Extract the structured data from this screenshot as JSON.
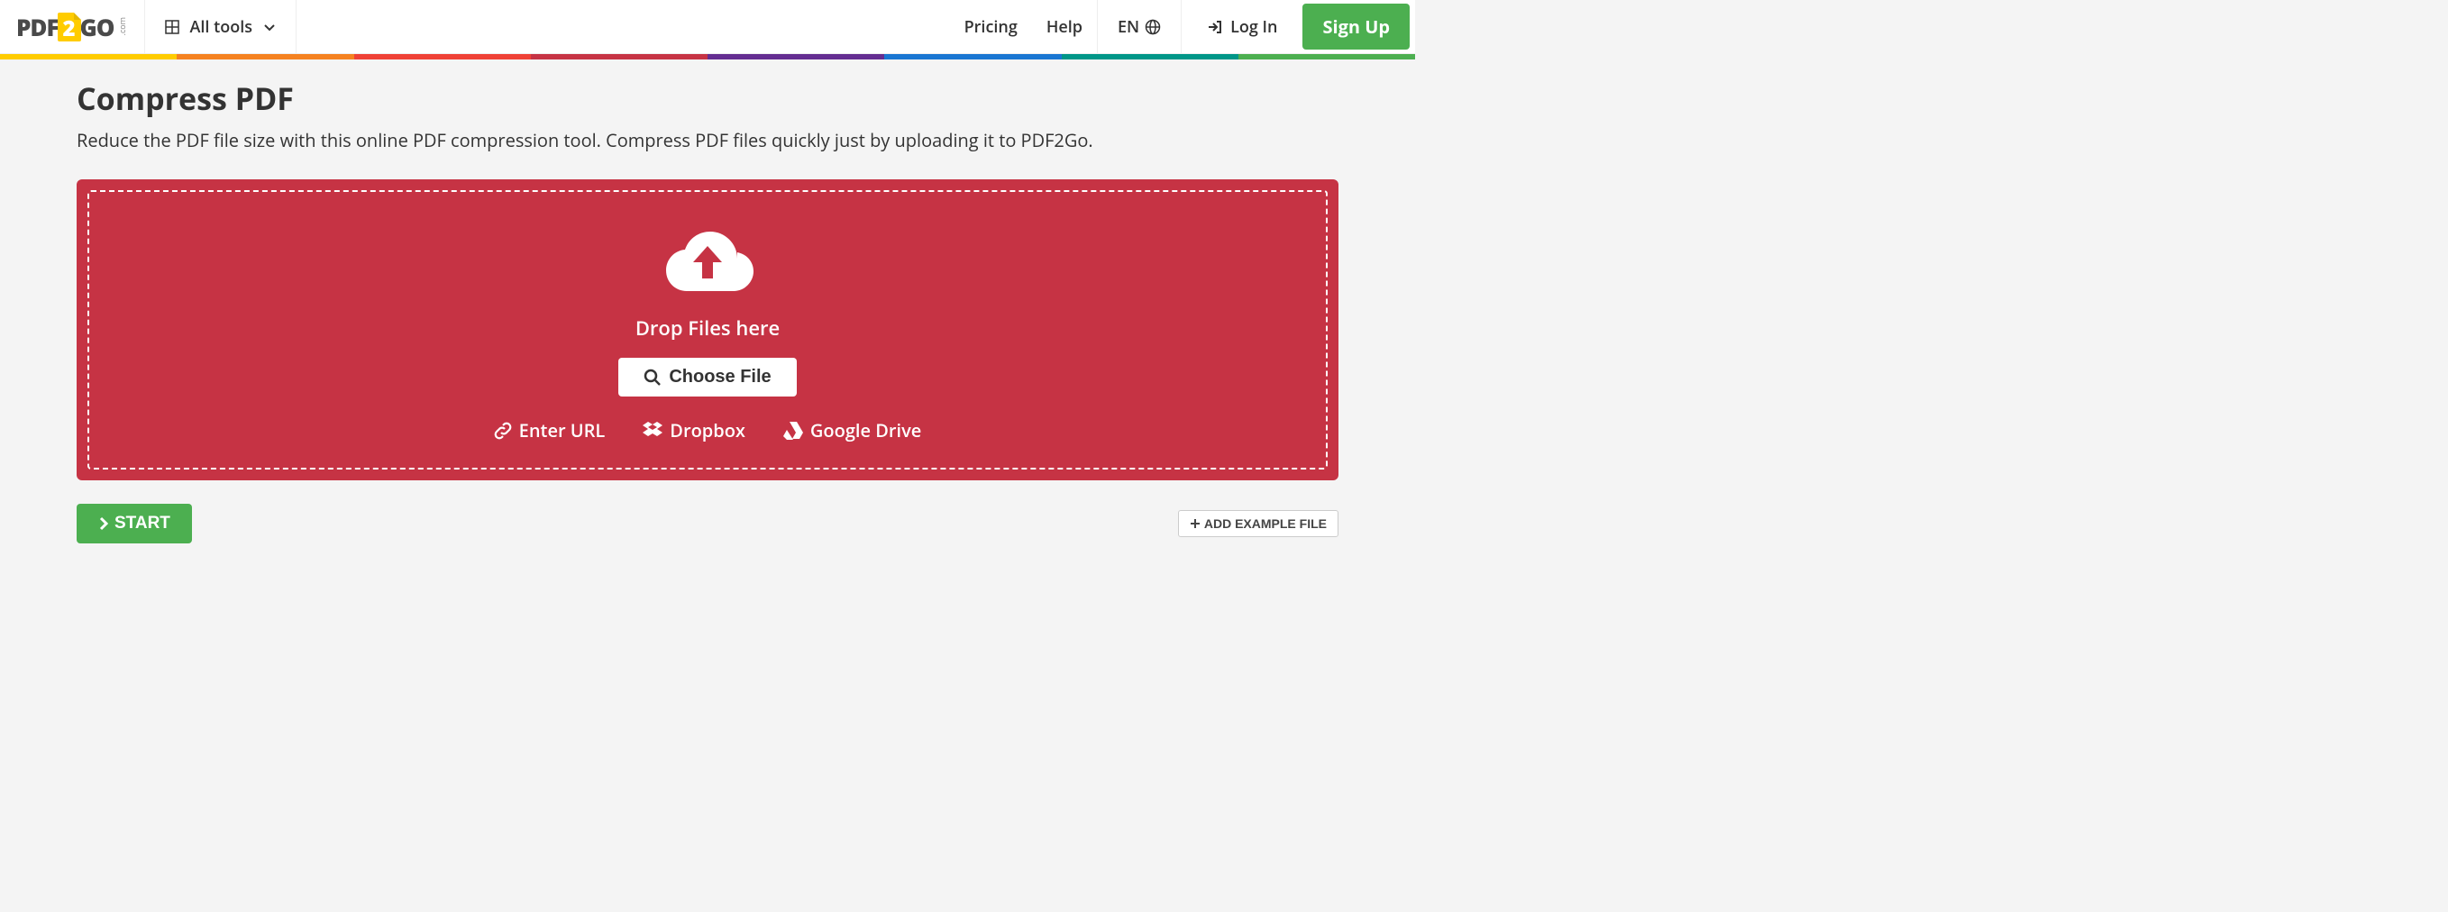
{
  "brand": {
    "left": "PDF",
    "right": "GO",
    "com": ".com"
  },
  "nav": {
    "all_tools": "All tools",
    "pricing": "Pricing",
    "help": "Help",
    "lang": "EN",
    "login": "Log In",
    "signup": "Sign Up"
  },
  "rainbow_colors": [
    "#FFCC00",
    "#F58220",
    "#EF4136",
    "#C63344",
    "#642D91",
    "#1976D2",
    "#009688",
    "#4CAF50"
  ],
  "page": {
    "title": "Compress PDF",
    "description": "Reduce the PDF file size with this online PDF compression tool. Compress PDF files quickly just by uploading it to PDF2Go."
  },
  "dropzone": {
    "drop_text": "Drop Files here",
    "choose_label": "Choose File",
    "enter_url": "Enter URL",
    "dropbox": "Dropbox",
    "gdrive": "Google Drive"
  },
  "actions": {
    "start": "START",
    "add_example": "ADD EXAMPLE FILE"
  }
}
